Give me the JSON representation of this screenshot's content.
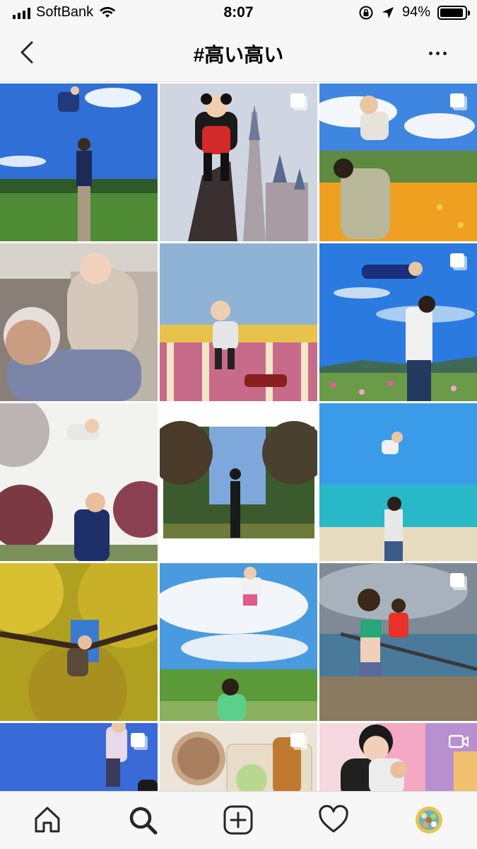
{
  "status": {
    "carrier": "SoftBank",
    "time": "8:07",
    "battery": "94%",
    "battery_level": 0.94
  },
  "header": {
    "title": "#高い高い"
  },
  "grid": {
    "tiles": [
      {
        "subject": "father lifting toddler in field under blue sky",
        "multi": false
      },
      {
        "subject": "toddler in mouse costume above castle",
        "multi": true
      },
      {
        "subject": "man lifting child over cosmos flower field",
        "multi": true
      },
      {
        "subject": "grandfather lifting laughing baby indoors",
        "multi": false
      },
      {
        "subject": "toddler lifted above carousel",
        "multi": false
      },
      {
        "subject": "man tossing child over flower field",
        "multi": true
      },
      {
        "subject": "baby tossed in park with autumn trees",
        "multi": false
      },
      {
        "subject": "silhouette lifting child between trees",
        "multi": false
      },
      {
        "subject": "man tossing child at turquoise beach",
        "multi": false
      },
      {
        "subject": "child tossed under yellow ginkgo trees",
        "multi": false
      },
      {
        "subject": "child jumping over green field",
        "multi": false
      },
      {
        "subject": "woman lifting child on beach",
        "multi": true
      },
      {
        "subject": "child lifted against blue sky",
        "multi": true
      },
      {
        "subject": "iced coffee and pastries on table",
        "multi": true
      },
      {
        "subject": "woman holding baby on play mat",
        "video": true
      }
    ]
  },
  "tabbar": {
    "items": [
      "home",
      "search",
      "create",
      "activity",
      "profile"
    ]
  },
  "colors": {
    "bar_bg": "#f7f7f7",
    "icon": "#262626"
  }
}
